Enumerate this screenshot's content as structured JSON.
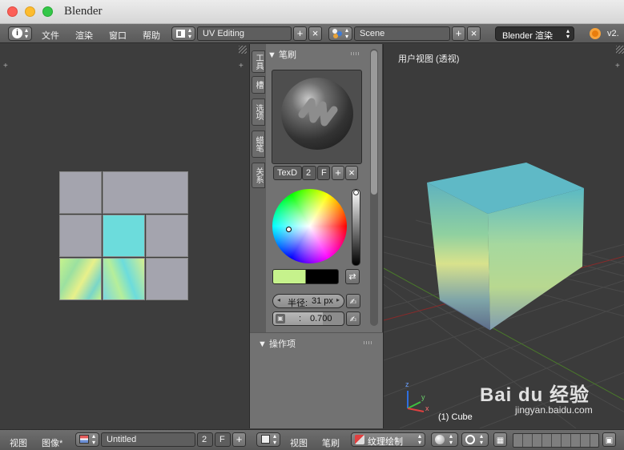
{
  "window": {
    "title": "Blender"
  },
  "topbar": {
    "menus": [
      "文件",
      "渲染",
      "窗口",
      "帮助"
    ],
    "layout_name": "UV Editing",
    "scene_name": "Scene",
    "render_engine": "Blender 渲染",
    "version": "v2."
  },
  "uv_editor": {
    "bottom_menus": [
      "视图",
      "图像*"
    ],
    "image_name": "Untitled",
    "image_users": "2",
    "fake_user": "F"
  },
  "tool_panel": {
    "tabs": [
      "工具",
      "槽",
      "选项",
      "蜡笔",
      "关系"
    ],
    "brush_section": "笔刷",
    "brush_name_field": "TexD",
    "brush_users": "2",
    "brush_fake": "F",
    "radius_label": "半径:",
    "radius_value": "31 px",
    "strength_label": ":",
    "strength_value": "0.700",
    "strength_fraction": 0.7,
    "operator_section": "操作项",
    "primary_color": "#c6f28c",
    "secondary_color": "#000000"
  },
  "viewport": {
    "view_label": "用户视图 (透视)",
    "object_label": "(1) Cube",
    "axis_labels": [
      "z",
      "y",
      "x"
    ],
    "bottom_menus": [
      "视图",
      "笔刷"
    ],
    "mode": "纹理绘制"
  },
  "watermark": {
    "brand": "Bai du 经验",
    "url": "jingyan.baidu.com"
  }
}
